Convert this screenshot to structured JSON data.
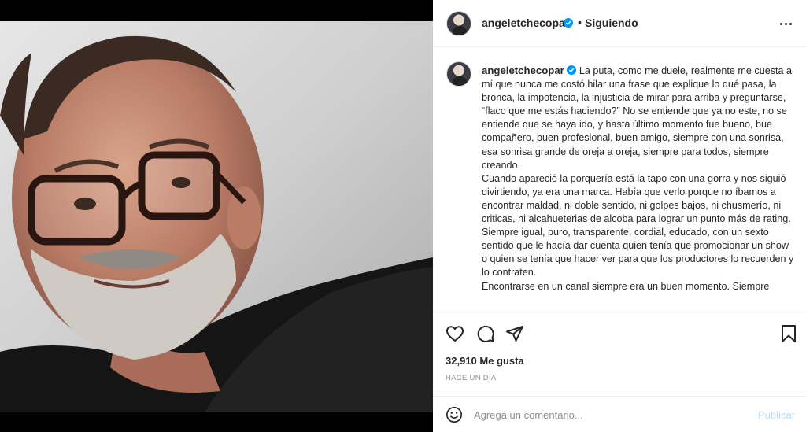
{
  "post": {
    "username": "angeletchecopar",
    "follow_status": "Siguiendo",
    "separator": "•",
    "caption_user": "angeletchecopar",
    "caption_text": "La puta, como me duele, realmente me cuesta a mí que nunca me costó hilar una frase que explique lo qué pasa, la bronca, la impotencia, la injusticia de mirar para arriba y preguntarse, “flaco que me estás haciendo?” No se entiende que ya no este, no se entiende que se haya ido, y hasta último momento fue bueno, bue compañero, buen profesional, buen amigo, siempre con una sonrisa, esa sonrisa grande de oreja a oreja, siempre para todos, siempre creando.\nCuando apareció la porquería está la tapo con una gorra y nos siguió divirtiendo, ya era una marca. Había que verlo porque no íbamos a encontrar maldad, ni doble sentido, ni golpes bajos, ni chusmerío, ni criticas, ni alcahueterias de alcoba para lograr un punto más de rating.\nSiempre igual, puro, transparente, cordial, educado, con un sexto sentido que le hacía dar cuenta quien tenía que promocionar un show o quien se tenía que hacer ver para que los productores lo recuerden y lo contraten.\nEncontrarse en un canal siempre era un buen momento. Siempre",
    "likes": "32,910 Me gusta",
    "time_ago": "HACE UN DÍA"
  },
  "comment": {
    "placeholder": "Agrega un comentario...",
    "publish_label": "Publicar"
  },
  "icons": {
    "header_more": "more-options-icon",
    "verified": "verified-badge-icon",
    "like": "heart-icon",
    "comment": "comment-icon",
    "share": "send-icon",
    "save": "bookmark-icon",
    "emoji": "emoji-icon"
  },
  "colors": {
    "verified_blue": "#0095f6",
    "publish_disabled": "#b2dffc",
    "secondary_text": "#8e8e8e",
    "divider": "#efefef"
  }
}
